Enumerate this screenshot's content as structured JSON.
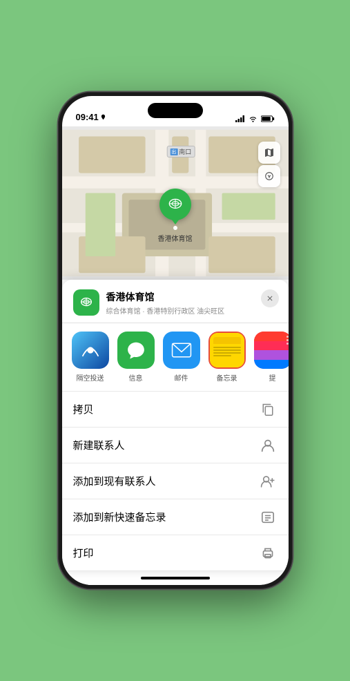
{
  "status": {
    "time": "09:41",
    "location_icon": true
  },
  "map": {
    "label_text": "南口",
    "map_type_btn": "🗺",
    "location_btn": "➤",
    "pin_label": "香港体育馆"
  },
  "venue": {
    "name": "香港体育馆",
    "subtitle": "综合体育馆 · 香港特别行政区 油尖旺区",
    "close_label": "×"
  },
  "share_items": [
    {
      "label": "隔空投送",
      "type": "airdrop"
    },
    {
      "label": "信息",
      "type": "messages"
    },
    {
      "label": "邮件",
      "type": "mail"
    },
    {
      "label": "备忘录",
      "type": "notes"
    },
    {
      "label": "提",
      "type": "more"
    }
  ],
  "actions": [
    {
      "label": "拷贝",
      "icon": "copy"
    },
    {
      "label": "新建联系人",
      "icon": "person"
    },
    {
      "label": "添加到现有联系人",
      "icon": "person-add"
    },
    {
      "label": "添加到新快速备忘录",
      "icon": "memo"
    },
    {
      "label": "打印",
      "icon": "print"
    }
  ]
}
